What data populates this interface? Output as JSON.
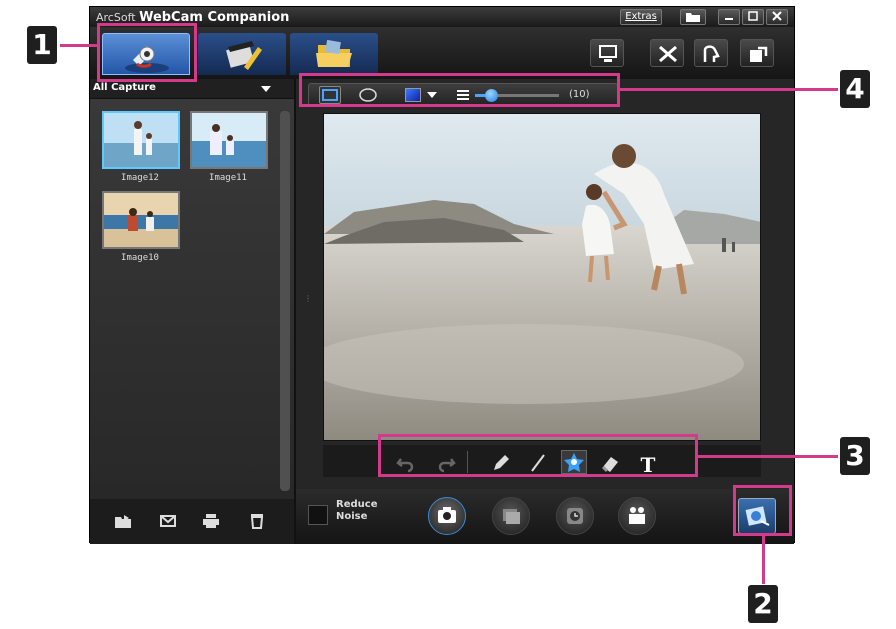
{
  "window": {
    "title_prefix": "ArcSoft",
    "title_app": "WebCam Companion",
    "extras_button": "Extras",
    "folder_icon": "folder-icon",
    "min_icon": "minimize-icon",
    "max_icon": "maximize-icon",
    "close_icon": "close-icon"
  },
  "mode_tabs": [
    {
      "name": "capture",
      "icon": "webcam-icon",
      "selected": true
    },
    {
      "name": "edit",
      "icon": "clapper-pencil-icon",
      "selected": false
    },
    {
      "name": "open",
      "icon": "folder-icon",
      "selected": false
    }
  ],
  "tools": [
    "monitor-icon",
    "tools-icon",
    "face-icon",
    "export-icon"
  ],
  "gallery": {
    "filter_label": "All Capture",
    "thumbnails": [
      {
        "label": "Image12",
        "selected": true
      },
      {
        "label": "Image11",
        "selected": false
      },
      {
        "label": "Image10",
        "selected": false
      }
    ],
    "bottom_icons": [
      "folder-share-icon",
      "email-icon",
      "print-icon",
      "trash-icon"
    ]
  },
  "edit_toolbar": {
    "shapes": [
      "rectangle-icon",
      "ellipse-icon"
    ],
    "color": "#1a3fd0",
    "brush_size_label": "(10)",
    "brush_size": 10
  },
  "draw_tools": [
    "undo-icon",
    "redo-icon",
    "pencil-icon",
    "line-icon",
    "stamp-icon",
    "eraser-icon",
    "text-icon"
  ],
  "text_tool_glyph": "T",
  "bottom": {
    "reduce_noise": "Reduce\nNoise",
    "capture_buttons": [
      "camera-icon",
      "frame-icon",
      "timer-icon",
      "video-icon"
    ]
  },
  "callouts": {
    "c1": "1",
    "c2": "2",
    "c3": "3",
    "c4": "4"
  },
  "colors": {
    "highlight": "#d43a8c",
    "accent_blue": "#2f6fd1"
  }
}
